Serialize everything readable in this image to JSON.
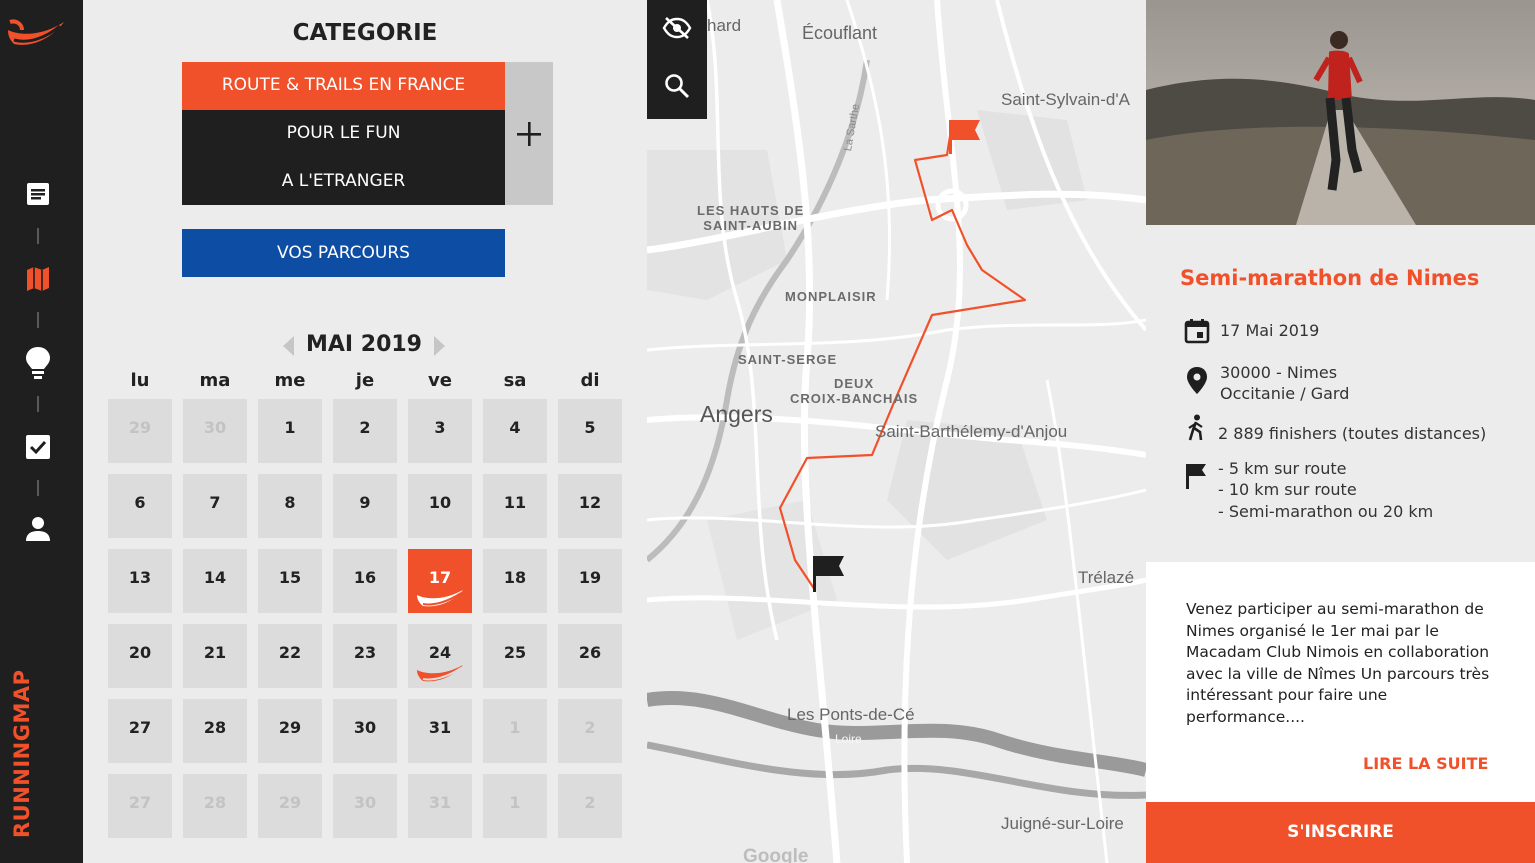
{
  "app": {
    "brand": "RUNNINGMAP"
  },
  "nav": {
    "items": [
      {
        "icon": "article-icon",
        "active": false
      },
      {
        "icon": "map-icon",
        "active": true
      },
      {
        "icon": "lightbulb-icon",
        "active": false
      },
      {
        "icon": "checkbox-icon",
        "active": false
      },
      {
        "icon": "user-icon",
        "active": false
      }
    ]
  },
  "categories": {
    "title": "CATEGORIE",
    "items": [
      "ROUTE & TRAILS  EN FRANCE",
      "POUR LE FUN",
      "A L'ETRANGER"
    ],
    "active_index": 0,
    "add_label": "+"
  },
  "parcours": {
    "label": "VOS PARCOURS"
  },
  "calendar": {
    "month": "MAI 2019",
    "weekdays": [
      "lu",
      "ma",
      "me",
      "je",
      "ve",
      "sa",
      "di"
    ],
    "weeks": [
      [
        {
          "d": "29",
          "m": true
        },
        {
          "d": "30",
          "m": true
        },
        {
          "d": "1"
        },
        {
          "d": "2"
        },
        {
          "d": "3"
        },
        {
          "d": "4"
        },
        {
          "d": "5"
        }
      ],
      [
        {
          "d": "6"
        },
        {
          "d": "7"
        },
        {
          "d": "8"
        },
        {
          "d": "9"
        },
        {
          "d": "10"
        },
        {
          "d": "11"
        },
        {
          "d": "12"
        }
      ],
      [
        {
          "d": "13"
        },
        {
          "d": "14"
        },
        {
          "d": "15"
        },
        {
          "d": "16"
        },
        {
          "d": "17",
          "sel": true,
          "event": true
        },
        {
          "d": "18"
        },
        {
          "d": "19"
        }
      ],
      [
        {
          "d": "20"
        },
        {
          "d": "21"
        },
        {
          "d": "22"
        },
        {
          "d": "23"
        },
        {
          "d": "24",
          "event": true
        },
        {
          "d": "25"
        },
        {
          "d": "26"
        }
      ],
      [
        {
          "d": "27"
        },
        {
          "d": "28"
        },
        {
          "d": "29"
        },
        {
          "d": "30"
        },
        {
          "d": "31"
        },
        {
          "d": "1",
          "m": true
        },
        {
          "d": "2",
          "m": true
        }
      ],
      [
        {
          "d": "27",
          "m": true
        },
        {
          "d": "28",
          "m": true
        },
        {
          "d": "29",
          "m": true
        },
        {
          "d": "30",
          "m": true
        },
        {
          "d": "31",
          "m": true
        },
        {
          "d": "1",
          "m": true
        },
        {
          "d": "2",
          "m": true
        }
      ]
    ]
  },
  "map": {
    "labels": {
      "hard": "hard",
      "ecouflant": "Écouflant",
      "saint_sylvain": "Saint-Sylvain-d'A",
      "hauts": "LES HAUTS DE\nSAINT-AUBIN",
      "monplaisir": "MONPLAISIR",
      "saint_serge": "SAINT-SERGE",
      "deux_croix": "DEUX\nCROIX-BANCHAIS",
      "angers": "Angers",
      "saint_barth": "Saint-Barthélemy-d'Anjou",
      "trelaze": "Trélazé",
      "ponts": "Les Ponts-de-Cé",
      "juigne": "Juigné-sur-Loire",
      "sarthe": "La Sarthe",
      "loire": "Loire",
      "google": "Google"
    },
    "route_color": "#f0512b",
    "tools": [
      {
        "icon": "eye-off-icon"
      },
      {
        "icon": "search-icon"
      }
    ]
  },
  "race": {
    "title": "Semi-marathon de Nimes",
    "date": "17 Mai 2019",
    "location_line1": "30000 - Nimes",
    "location_line2": "Occitanie / Gard",
    "finishers": "2 889 finishers (toutes distances)",
    "distances": [
      "- 5 km sur route",
      "- 10 km sur route",
      "- Semi-marathon ou 20 km"
    ],
    "description": "Venez participer au semi-marathon de Nimes organisé le 1er mai par le Macadam Club Nimois en collaboration avec la ville de Nîmes Un parcours très intéressant pour faire une performance....",
    "read_more": "LIRE LA SUITE",
    "register": "S'INSCRIRE"
  },
  "colors": {
    "accent": "#f0512b",
    "dark": "#1f1f1f",
    "blue": "#0e4da4"
  }
}
